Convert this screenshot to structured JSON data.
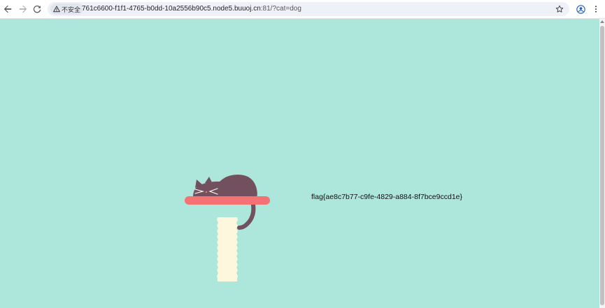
{
  "browser": {
    "security_label": "不安全",
    "url_host": "761c6600-f1f1-4765-b0dd-10a2556b90c5.node5.buuoj.cn",
    "url_rest": ":81/?cat=dog",
    "icons": {
      "back": "back-arrow-icon",
      "forward": "forward-arrow-icon",
      "reload": "reload-icon",
      "warning": "warning-icon",
      "bookmark": "star-icon",
      "profile": "profile-icon",
      "menu": "more-vert-icon"
    }
  },
  "page": {
    "background_color": "#ade6da",
    "flag_text": "flag{ae8c7b77-c9fe-4829-a884-8f7bce9ccd1e}",
    "illustration": "cat-sleeping-on-scratching-post",
    "colors": {
      "cat": "#72505d",
      "shelf": "#f47174",
      "post": "#fdf7dd"
    }
  }
}
